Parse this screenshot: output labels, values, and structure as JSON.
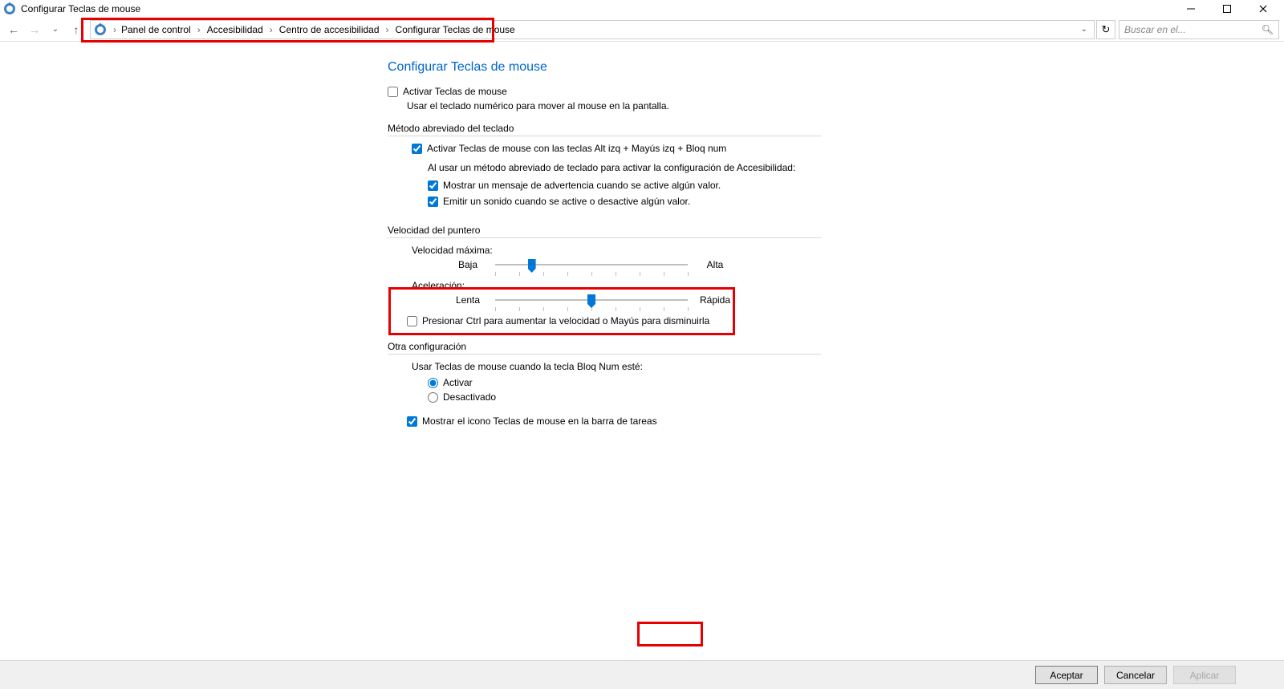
{
  "window": {
    "title": "Configurar Teclas de mouse"
  },
  "nav": {
    "breadcrumbs": [
      "Panel de control",
      "Accesibilidad",
      "Centro de accesibilidad",
      "Configurar Teclas de mouse"
    ],
    "search_placeholder": "Buscar en el..."
  },
  "page": {
    "heading": "Configurar Teclas de mouse",
    "activate_label": "Activar Teclas de mouse",
    "activate_checked": false,
    "activate_desc": "Usar el teclado numérico para mover al mouse en la pantalla.",
    "shortcut": {
      "title": "Método abreviado del teclado",
      "enable_with_keys_label": "Activar Teclas de mouse con las teclas Alt izq + Mayús izq + Bloq num",
      "enable_with_keys_checked": true,
      "subheading": "Al usar un método abreviado de teclado para activar la configuración de Accesibilidad:",
      "show_warning_label": "Mostrar un mensaje de advertencia cuando se active algún valor.",
      "show_warning_checked": true,
      "play_sound_label": "Emitir un sonido cuando se active o desactive algún valor.",
      "play_sound_checked": true
    },
    "speed": {
      "title": "Velocidad del puntero",
      "max_speed_label": "Velocidad máxima:",
      "max_low": "Baja",
      "max_high": "Alta",
      "max_value_pct": 19,
      "accel_label": "Aceleración:",
      "accel_low": "Lenta",
      "accel_high": "Rápida",
      "accel_value_pct": 50,
      "ctrl_shift_label": "Presionar Ctrl para aumentar la velocidad o Mayús para disminuirla",
      "ctrl_shift_checked": false
    },
    "other": {
      "title": "Otra configuración",
      "numlock_label": "Usar Teclas de mouse cuando la tecla Bloq Num esté:",
      "radio_on_label": "Activar",
      "radio_off_label": "Desactivado",
      "radio_selected": "on",
      "show_tray_label": "Mostrar el icono Teclas de mouse en la barra de tareas",
      "show_tray_checked": true
    }
  },
  "footer": {
    "ok": "Aceptar",
    "cancel": "Cancelar",
    "apply": "Aplicar"
  }
}
